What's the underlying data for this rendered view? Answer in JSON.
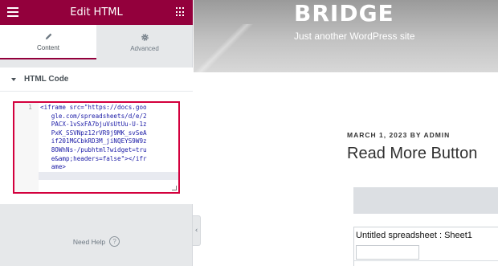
{
  "editor": {
    "title": "Edit HTML",
    "tabs": [
      {
        "label": "Content",
        "icon": "pencil-icon",
        "active": true
      },
      {
        "label": "Advanced",
        "icon": "gear-icon",
        "active": false
      }
    ],
    "section_label": "HTML Code",
    "code": {
      "line_number": "1",
      "value": "<iframe src=\"https://docs.google.com/spreadsheets/d/e/2PACX-1vSxFA7bjuVsUtUu-U-1zPxK_SSVNpz12rVR9j9MK_svSeAif201MGCbkRD3M_jiNQEYS9W9z8OWhNs-/pubhtml?widget=true&amp;headers=false\"></iframe>"
    },
    "need_help": "Need Help",
    "accent_color": "#93003c"
  },
  "preview": {
    "site_title": "BRIDGE",
    "tagline": "Just another WordPress site",
    "post_date": "MARCH 1, 2023",
    "post_by": "BY",
    "post_author": "ADMIN",
    "post_title": "Read More Button",
    "spreadsheet_title": "Untitled spreadsheet : Sheet1"
  }
}
